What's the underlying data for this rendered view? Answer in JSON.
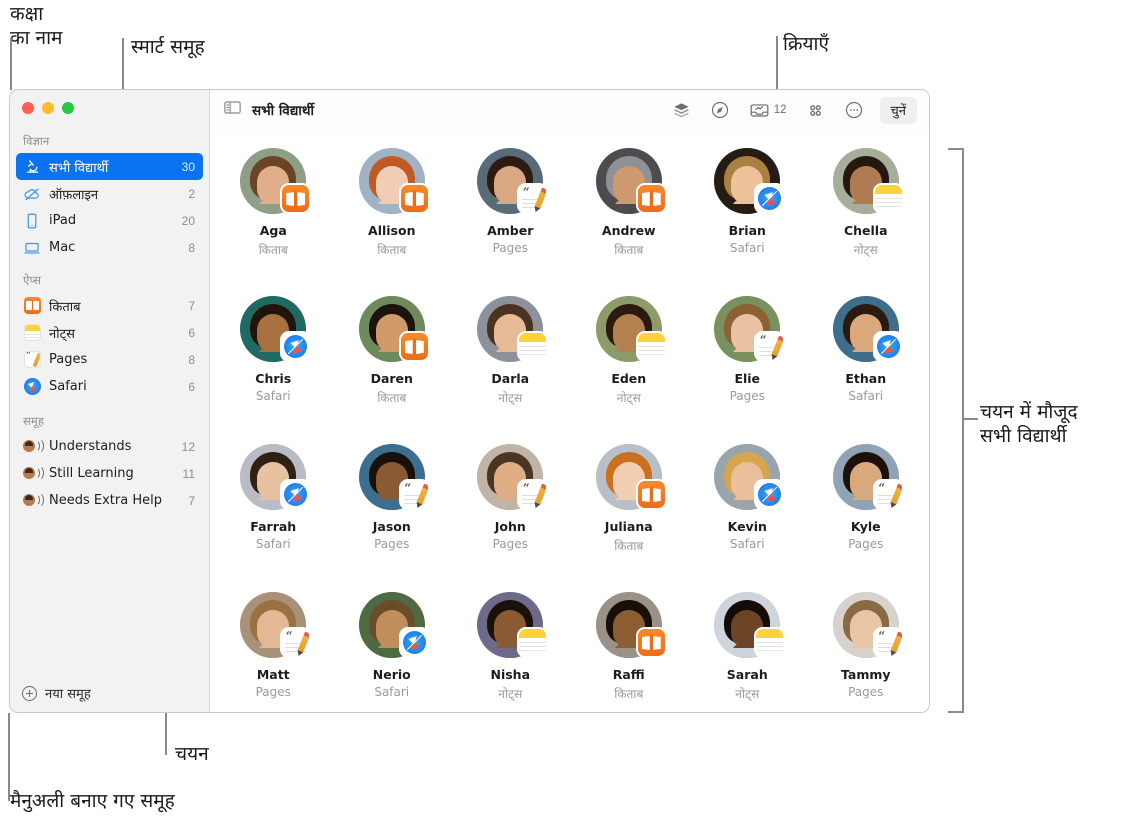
{
  "annotations": {
    "class_name": "कक्षा\nका नाम",
    "smart_group": "स्मार्ट समूह",
    "actions": "क्रियाएँ",
    "all_students_in_selection": "चयन में मौजूद\nसभी विद्यार्थी",
    "selection": "चयन",
    "manual_groups": "मैनुअली बनाए गए समूह"
  },
  "window": {
    "traffic_lights": [
      "close",
      "minimize",
      "zoom"
    ]
  },
  "sidebar": {
    "sections": [
      {
        "title": "विज्ञान",
        "items": [
          {
            "icon": "microscope-icon",
            "label": "सभी विद्यार्थी",
            "count": "30",
            "selected": true
          },
          {
            "icon": "offline-cloud-icon",
            "label": "ऑफ़लाइन",
            "count": "2",
            "selected": false
          },
          {
            "icon": "ipad-icon",
            "label": "iPad",
            "count": "20",
            "selected": false
          },
          {
            "icon": "mac-icon",
            "label": "Mac",
            "count": "8",
            "selected": false
          }
        ]
      },
      {
        "title": "ऐप्स",
        "items": [
          {
            "icon": "books-app-icon",
            "label": "किताब",
            "count": "7",
            "selected": false
          },
          {
            "icon": "notes-app-icon",
            "label": "नोट्स",
            "count": "6",
            "selected": false
          },
          {
            "icon": "pages-app-icon",
            "label": "Pages",
            "count": "8",
            "selected": false
          },
          {
            "icon": "safari-app-icon",
            "label": "Safari",
            "count": "6",
            "selected": false
          }
        ]
      },
      {
        "title": "समूह",
        "items": [
          {
            "icon": "group-icon",
            "label": "Understands",
            "count": "12",
            "selected": false
          },
          {
            "icon": "group-icon",
            "label": "Still Learning",
            "count": "11",
            "selected": false
          },
          {
            "icon": "group-icon",
            "label": "Needs Extra Help",
            "count": "7",
            "selected": false
          }
        ]
      }
    ],
    "footer": {
      "icon": "plus-circle-icon",
      "label": "नया समूह"
    }
  },
  "toolbar": {
    "sidebar_toggle_icon": "sidebar-toggle-icon",
    "title": "सभी विद्यार्थी",
    "actions": [
      {
        "icon": "layers-icon",
        "label": "",
        "badge": ""
      },
      {
        "icon": "navigate-compass-icon",
        "label": "",
        "badge": ""
      },
      {
        "icon": "inbox-tray-icon",
        "label": "",
        "badge": "12"
      },
      {
        "icon": "grid-apps-icon",
        "label": "",
        "badge": ""
      },
      {
        "icon": "more-ellipsis-icon",
        "label": "",
        "badge": ""
      }
    ],
    "choose_label": "चुनें"
  },
  "students": [
    {
      "name": "Aga",
      "app": "किताब",
      "badge": "books",
      "skin": "#e0ae8b",
      "hair": "#6b4426",
      "bg": "#8f9e86"
    },
    {
      "name": "Allison",
      "app": "किताब",
      "badge": "books",
      "skin": "#f0cdb4",
      "hair": "#c05a22",
      "bg": "#9fb3c4"
    },
    {
      "name": "Amber",
      "app": "Pages",
      "badge": "pages",
      "skin": "#d9a781",
      "hair": "#2d1c12",
      "bg": "#5a6b78"
    },
    {
      "name": "Andrew",
      "app": "किताब",
      "badge": "books",
      "skin": "#cf9a6e",
      "hair": "#8f9196",
      "bg": "#4c4c4e"
    },
    {
      "name": "Brian",
      "app": "Safari",
      "badge": "safari",
      "skin": "#edc19a",
      "hair": "#a9803f",
      "bg": "#241c15"
    },
    {
      "name": "Chella",
      "app": "नोट्स",
      "badge": "notes",
      "skin": "#b07b52",
      "hair": "#24180f",
      "bg": "#a6ae9a"
    },
    {
      "name": "Chris",
      "app": "Safari",
      "badge": "safari",
      "skin": "#a9713f",
      "hair": "#20150c",
      "bg": "#1f6b63"
    },
    {
      "name": "Daren",
      "app": "किताब",
      "badge": "books",
      "skin": "#d09a6b",
      "hair": "#1c130c",
      "bg": "#6e8a5c"
    },
    {
      "name": "Darla",
      "app": "नोट्स",
      "badge": "notes",
      "skin": "#e7bb98",
      "hair": "#4a3320",
      "bg": "#8d929a"
    },
    {
      "name": "Eden",
      "app": "नोट्स",
      "badge": "notes",
      "skin": "#b5804f",
      "hair": "#2b1b0f",
      "bg": "#8d9a6a"
    },
    {
      "name": "Elie",
      "app": "Pages",
      "badge": "pages",
      "skin": "#eac2a1",
      "hair": "#8d6134",
      "bg": "#78915f"
    },
    {
      "name": "Ethan",
      "app": "Safari",
      "badge": "safari",
      "skin": "#dba87c",
      "hair": "#2a1a10",
      "bg": "#3f6d8c"
    },
    {
      "name": "Farrah",
      "app": "Safari",
      "badge": "safari",
      "skin": "#e8c2a0",
      "hair": "#2f2014",
      "bg": "#b9bcc4"
    },
    {
      "name": "Jason",
      "app": "Pages",
      "badge": "pages",
      "skin": "#8a5a32",
      "hair": "#19100a",
      "bg": "#3c6f8f"
    },
    {
      "name": "John",
      "app": "Pages",
      "badge": "pages",
      "skin": "#dfae86",
      "hair": "#4a3521",
      "bg": "#c0b4a6"
    },
    {
      "name": "Juliana",
      "app": "किताब",
      "badge": "books",
      "skin": "#f2cfb2",
      "hair": "#c9711f",
      "bg": "#b9bfc6"
    },
    {
      "name": "Kevin",
      "app": "Safari",
      "badge": "safari",
      "skin": "#e9c09b",
      "hair": "#d6a64e",
      "bg": "#9aa4ac"
    },
    {
      "name": "Kyle",
      "app": "Pages",
      "badge": "pages",
      "skin": "#d9a97e",
      "hair": "#1b1108",
      "bg": "#8fa3b4"
    },
    {
      "name": "Matt",
      "app": "Pages",
      "badge": "pages",
      "skin": "#e3b894",
      "hair": "#9a7140",
      "bg": "#a99078"
    },
    {
      "name": "Nerio",
      "app": "Safari",
      "badge": "safari",
      "skin": "#c08d5c",
      "hair": "#6a4b2a",
      "bg": "#4e6a42"
    },
    {
      "name": "Nisha",
      "app": "नोट्स",
      "badge": "notes",
      "skin": "#8a5a33",
      "hair": "#1a110a",
      "bg": "#6e6a8a"
    },
    {
      "name": "Raffi",
      "app": "किताब",
      "badge": "books",
      "skin": "#8c5c33",
      "hair": "#181008",
      "bg": "#9a9287"
    },
    {
      "name": "Sarah",
      "app": "नोट्स",
      "badge": "notes",
      "skin": "#6e4427",
      "hair": "#130c07",
      "bg": "#cfd3dd"
    },
    {
      "name": "Tammy",
      "app": "Pages",
      "badge": "pages",
      "skin": "#eac5a6",
      "hair": "#8a6a44",
      "bg": "#d8d2cc"
    }
  ]
}
